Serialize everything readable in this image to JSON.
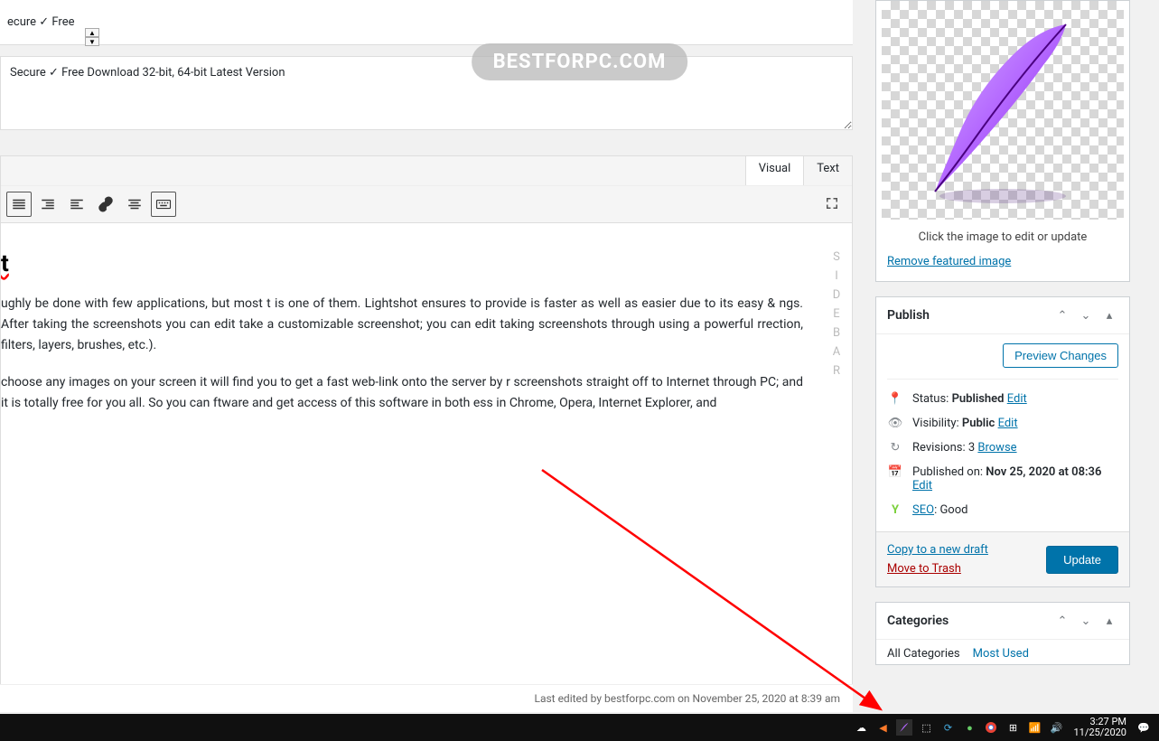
{
  "top_input": {
    "partial": "ecure ✓ Free"
  },
  "textarea": {
    "value": "Secure ✓ Free Download 32-bit, 64-bit Latest Version"
  },
  "watermark": "BESTFORPC.COM",
  "editor": {
    "tabs": {
      "visual": "Visual",
      "text": "Text"
    }
  },
  "article": {
    "title_suffix": "t",
    "p1": "ughly be done with few applications, but most t is one of them. Lightshot ensures to provide is faster as well as easier due to its easy & ngs. After taking the screenshots you can edit take a customizable screenshot; you can edit taking screenshots through using a powerful rrection, filters, layers, brushes, etc.).",
    "p2": "choose any images on your screen it will find you to get a fast web-link onto the server by r screenshots straight off to Internet through PC; and it is totally free for you all. So you can ftware and get access of this software in both ess in Chrome, Opera, Internet Explorer, and"
  },
  "sidebar_letters": [
    "S",
    "I",
    "D",
    "E",
    "B",
    "A",
    "R"
  ],
  "last_edited": "Last edited by bestforpc.com on November 25, 2020 at 8:39 am",
  "featured_image": {
    "hint": "Click the image to edit or update",
    "remove": "Remove featured image"
  },
  "publish": {
    "title": "Publish",
    "preview": "Preview Changes",
    "status_label": "Status:",
    "status_value": "Published",
    "visibility_label": "Visibility:",
    "visibility_value": "Public",
    "revisions_label": "Revisions:",
    "revisions_value": "3",
    "browse": "Browse",
    "published_label": "Published on:",
    "published_value": "Nov 25, 2020 at 08:36",
    "seo_label": "SEO",
    "seo_value": "Good",
    "edit": "Edit",
    "copy": "Copy to a new draft",
    "trash": "Move to Trash",
    "update": "Update"
  },
  "categories": {
    "title": "Categories",
    "tabs": {
      "all": "All Categories",
      "most_used": "Most Used"
    }
  },
  "taskbar": {
    "time": "3:27 PM",
    "date": "11/25/2020"
  }
}
